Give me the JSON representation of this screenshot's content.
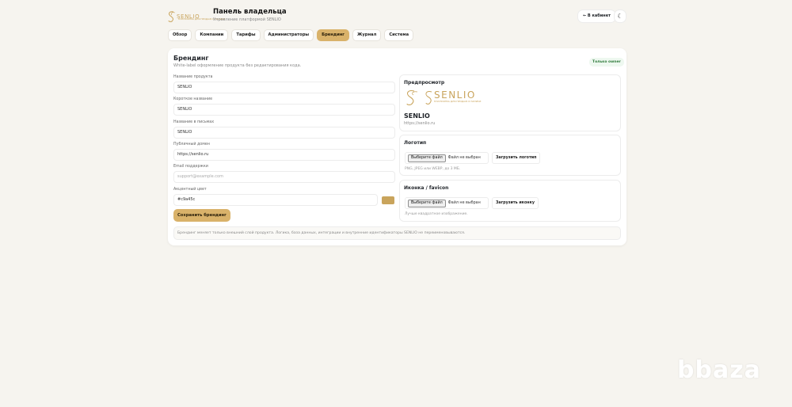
{
  "header": {
    "logo_text": "SENLIO",
    "logo_tagline": "ПЛАТФОРМА ДЛЯ ПРОДАЖ И ЗАПИСИ",
    "title": "Панель владельца",
    "subtitle": "Управление платформой SENLIO",
    "cabinet_button": "← В кабинет",
    "theme_button": "☾"
  },
  "tabs": [
    {
      "label": "Обзор",
      "active": false
    },
    {
      "label": "Компании",
      "active": false
    },
    {
      "label": "Тарифы",
      "active": false
    },
    {
      "label": "Администраторы",
      "active": false
    },
    {
      "label": "Брендинг",
      "active": true
    },
    {
      "label": "Журнал",
      "active": false
    },
    {
      "label": "Система",
      "active": false
    }
  ],
  "branding": {
    "title": "Брендинг",
    "description": "White-label оформление продукта без редактирования кода.",
    "badge": "Только owner",
    "fields": {
      "product_name": {
        "label": "Название продукта",
        "value": "SENLIO"
      },
      "short_name": {
        "label": "Короткое название",
        "value": "SENLIO"
      },
      "email_name": {
        "label": "Название в письмах",
        "value": "SENLIO"
      },
      "public_domain": {
        "label": "Публичный домен",
        "value": "https://senlio.ru"
      },
      "support_email": {
        "label": "Email поддержки",
        "value": "",
        "placeholder": "support@example.com"
      },
      "accent_color": {
        "label": "Акцентный цвет",
        "value": "#c9a45c"
      }
    },
    "save_button": "Сохранить брендинг",
    "note": "Брендинг меняет только внешний слой продукта. Логика, база данных, интеграции и внутренние идентификаторы SENLIO не переименовываются."
  },
  "preview": {
    "title": "Предпросмотр",
    "logo_text": "SENLIO",
    "logo_tagline": "ПЛАТФОРМА ДЛЯ ПРОДАЖ И ЗАПИСИ",
    "name": "SENLIO",
    "url": "https://senlio.ru"
  },
  "logo_upload": {
    "title": "Логотип",
    "choose_label": "Выберите файл",
    "status": "Файл не выбран",
    "upload_button": "Загрузить логотип",
    "hint": "PNG, JPEG или WEBP, до 3 МБ."
  },
  "favicon_upload": {
    "title": "Иконка / favicon",
    "choose_label": "Выберите файл",
    "status": "Файл не выбран",
    "upload_button": "Загрузить иконку",
    "hint": "Лучше квадратное изображение."
  },
  "colors": {
    "accent": "#d9b26a",
    "logo_gold": "#c9a45c",
    "badge_green": "#2f7a3b"
  },
  "watermark": "bbaza"
}
